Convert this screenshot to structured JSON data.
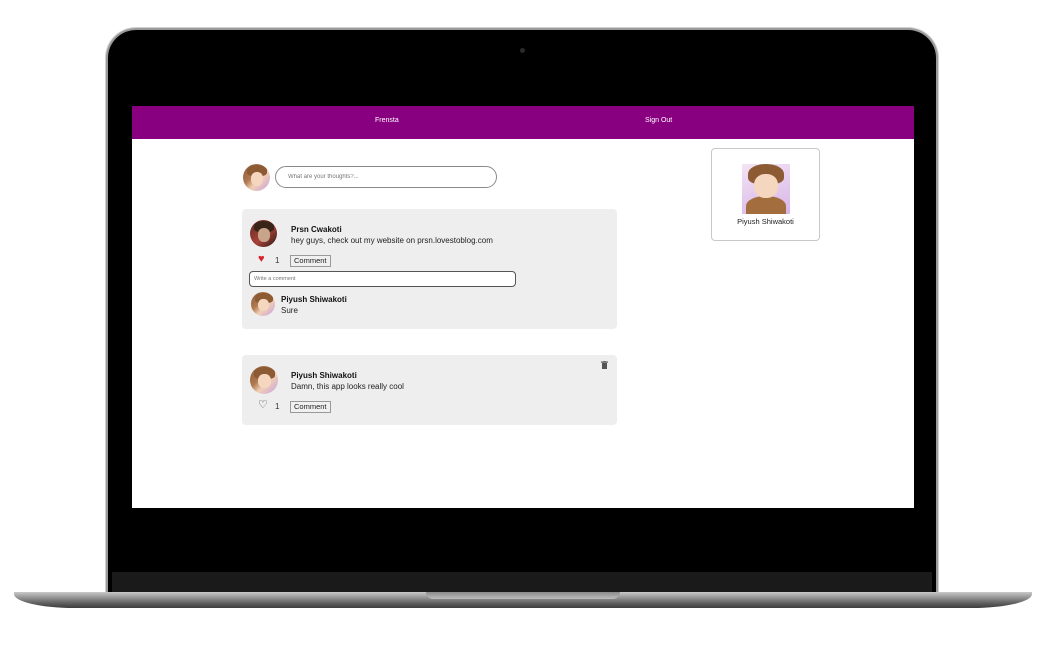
{
  "nav": {
    "brand": "Frensta",
    "signout": "Sign Out",
    "bar_color": "#880080"
  },
  "composer": {
    "placeholder": "What are your thoughts?..."
  },
  "posts": [
    {
      "author": "Prsn Cwakoti",
      "text": "hey guys, check out my website on prsn.lovestoblog.com",
      "likes": "1",
      "liked": true,
      "comment_label": "Comment",
      "comment_placeholder": "Write a comment",
      "comments": [
        {
          "author": "Piyush Shiwakoti",
          "text": "Sure"
        }
      ]
    },
    {
      "author": "Piyush Shiwakoti",
      "text": "Damn, this app looks really cool",
      "likes": "1",
      "liked": false,
      "comment_label": "Comment"
    }
  ],
  "profile": {
    "name": "Piyush Shiwakoti"
  },
  "icons": {
    "heart_filled": "heart-filled-icon",
    "heart_outline": "heart-outline-icon",
    "trash": "trash-icon"
  }
}
